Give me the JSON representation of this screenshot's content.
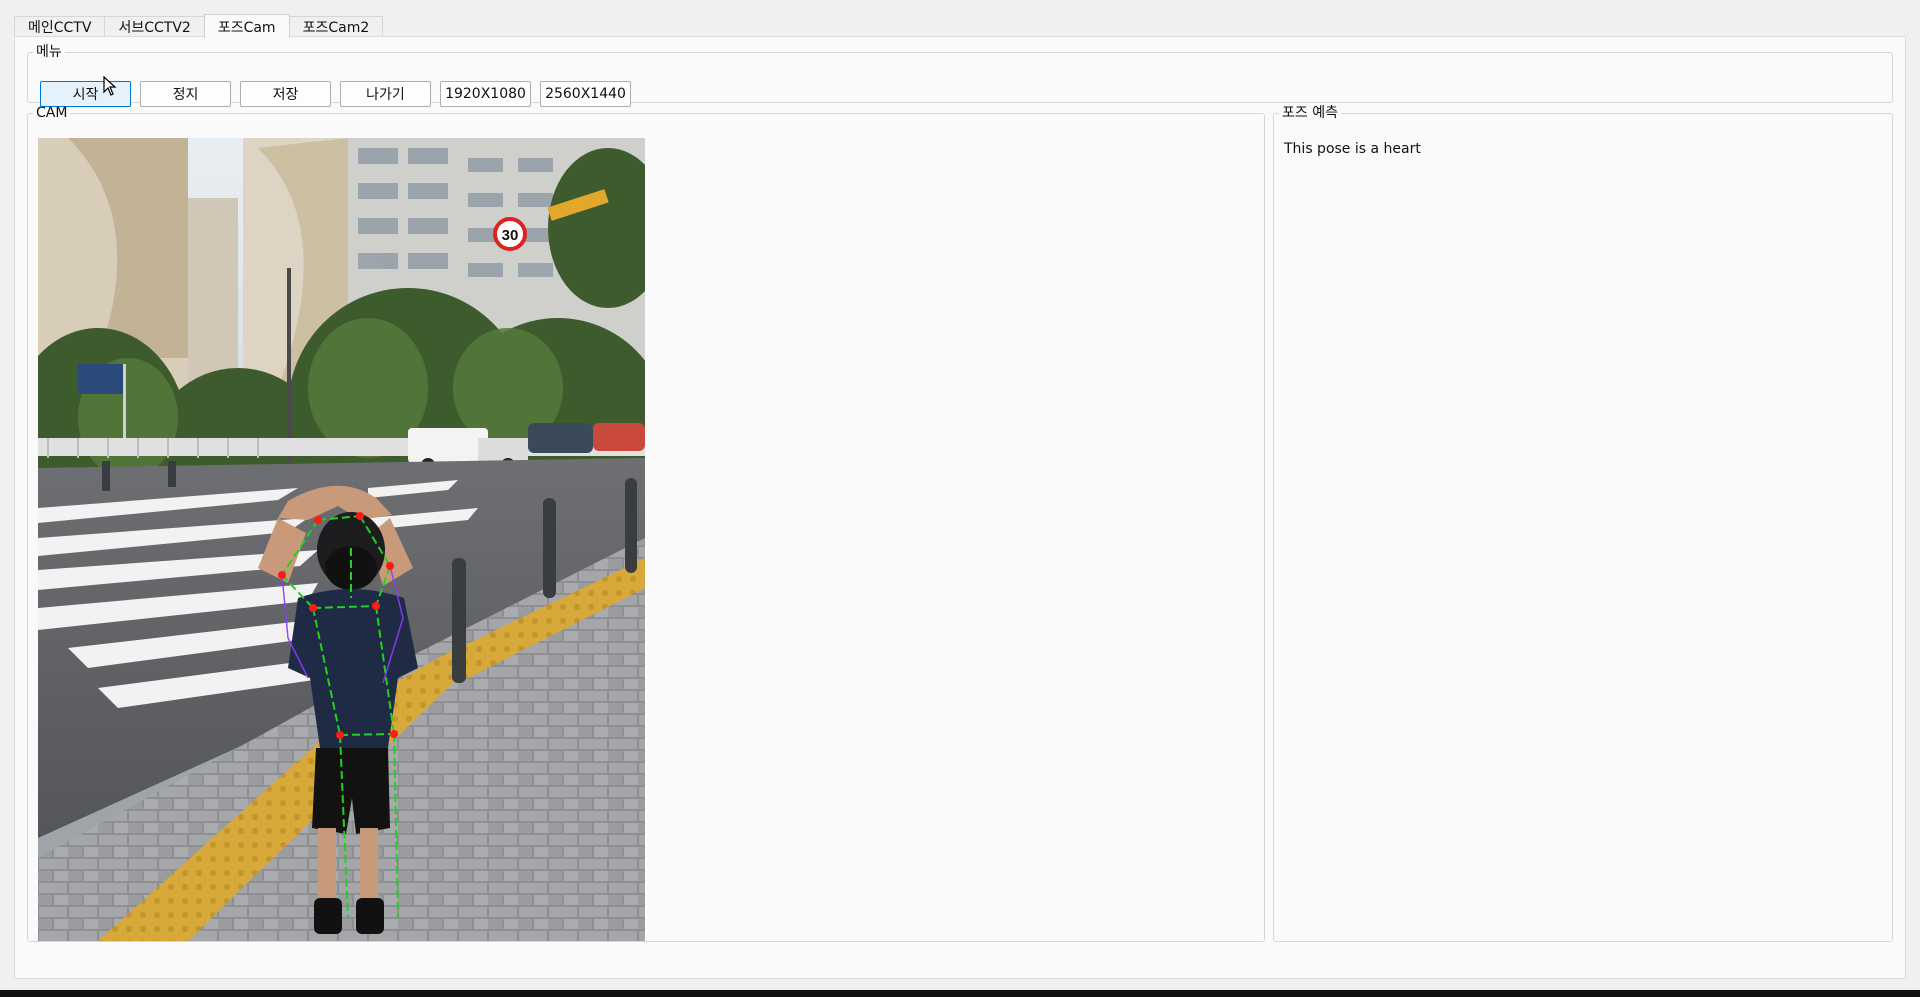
{
  "tabs": [
    {
      "label": "메인CCTV"
    },
    {
      "label": "서브CCTV2"
    },
    {
      "label": "포즈Cam"
    },
    {
      "label": "포즈Cam2"
    }
  ],
  "menu": {
    "title": "메뉴",
    "buttons": {
      "start": "시작",
      "stop": "정지",
      "save": "저장",
      "exit": "나가기",
      "res1": "1920X1080",
      "res2": "2560X1440"
    }
  },
  "cam": {
    "title": "CAM",
    "speed_sign": "30"
  },
  "prediction": {
    "title": "포즈 예측",
    "result": "This pose is a heart"
  },
  "colors": {
    "skeleton_line": "#1fd21f",
    "joint": "#ff1a1a",
    "outline": "#8a3cff",
    "active_button": "#e5f1fb"
  }
}
